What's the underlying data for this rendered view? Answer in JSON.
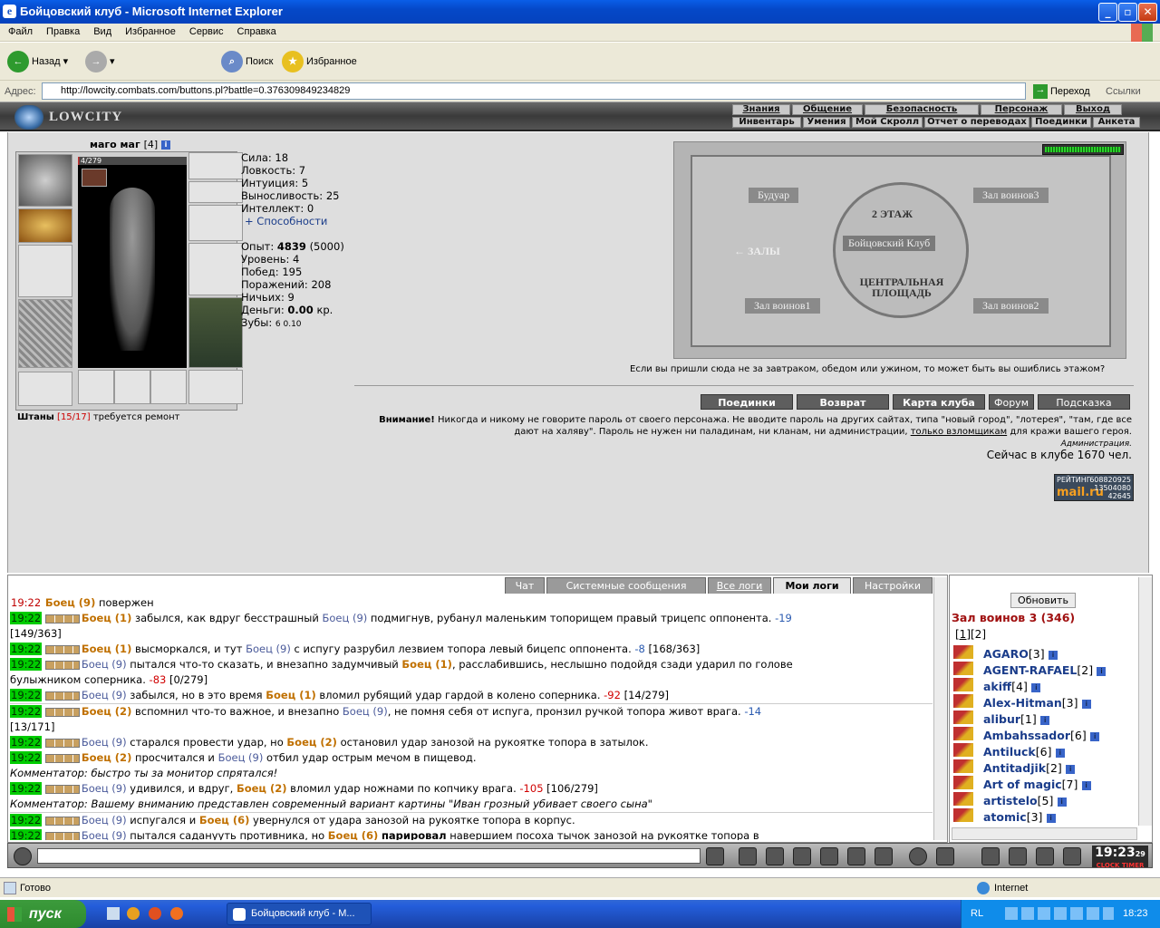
{
  "window": {
    "title": "Бойцовский клуб - Microsoft Internet Explorer"
  },
  "menu": [
    "Файл",
    "Правка",
    "Вид",
    "Избранное",
    "Сервис",
    "Справка"
  ],
  "toolbar": {
    "back": "Назад",
    "search": "Поиск",
    "favorites": "Избранное"
  },
  "address": {
    "label": "Адрес:",
    "url": "http://lowcity.combats.com/buttons.pl?battle=0.376309849234829",
    "go": "Переход",
    "links": "Ссылки"
  },
  "game": {
    "logo": "LOWCITY",
    "menu_top": [
      "Знания",
      "Общение",
      "Безопасность",
      "Персонаж",
      "Выход"
    ],
    "menu_bottom": [
      "Инвентарь",
      "Умения",
      "Мой Скролл",
      "Отчет о переводах",
      "Поединки",
      "Анкета"
    ]
  },
  "character": {
    "name": "маго маг",
    "level": "[4]",
    "hp": "4/279",
    "hp_fraction": 0.014,
    "stats": {
      "strength": "Сила: 18",
      "agility": "Ловкость: 7",
      "intuition": "Интуиция: 5",
      "endurance": "Выносливость: 25",
      "intellect": "Интеллект: 0",
      "abilities": "+ Способности"
    },
    "exp_label": "Опыт:",
    "exp_value": "4839",
    "exp_next": "(5000)",
    "level_line": "Уровень: 4",
    "wins": "Побед: 195",
    "losses": "Поражений: 208",
    "draws": "Ничьих: 9",
    "money_label": "Деньги:",
    "money_value": "0.00",
    "money_unit": "кр.",
    "teeth_label": "Зубы:",
    "teeth_value": "6 0.10",
    "repair_item": "Штаны",
    "repair_dur": "[15/17]",
    "repair_text": "требуется ремонт"
  },
  "map": {
    "labels": [
      "Будуар",
      "Зал воинов3",
      "2 ЭТАЖ",
      "Бойцовский Клуб",
      "← ЗАЛЫ",
      "ЦЕНТРАЛЬНАЯ ПЛОЩАДЬ",
      "Зал воинов1",
      "Зал воинов2"
    ],
    "caption": "Если вы пришли сюда не за завтраком, обедом или ужином, то может быть вы ошиблись этажом?"
  },
  "nav_buttons": [
    "Поединки",
    "Возврат",
    "Карта клуба",
    "Форум",
    "Подсказка"
  ],
  "warning": {
    "title": "Внимание!",
    "text": "Никогда и никому не говорите пароль от своего персонажа. Не вводите пароль на других сайтах, типа \"новый город\", \"лотерея\", \"там, где все дают на халяву\". Пароль не нужен ни паладинам, ни кланам, ни администрации,",
    "link": "только взломщикам",
    "tail": "для кражи вашего героя.",
    "sign": "Администрация."
  },
  "online": "Сейчас в клубе 1670 чел.",
  "rating": {
    "title": "РЕЙТИНГ",
    "brand": "mail.ru",
    "n1": "608820925",
    "n2": "13504080",
    "n3": "42645"
  },
  "log_tabs": [
    "Чат",
    "Системные сообщения",
    "Все логи",
    "Мои логи",
    "Настройки"
  ],
  "log": [
    {
      "t": "19:22",
      "red": true,
      "a": "Боец (9)",
      "text": " повержен"
    },
    {
      "t": "19:22",
      "a": "Боец (1)",
      "text": " забылся, как вдруг бесстрашный ",
      "b": "Боец (9)",
      "text2": " подмигнув, рубанул маленьким топорищем правый трицепс оппонента. ",
      "d": "-19",
      "hp": ""
    },
    {
      "cont": "[149/363]"
    },
    {
      "t": "19:22",
      "a": "Боец (1)",
      "text": " высморкался, и тут ",
      "b": "Боец (9)",
      "text2": " с испугу разрубил лезвием топора левый бицепс оппонента. ",
      "d": "-8",
      "hp": " [168/363]"
    },
    {
      "t": "19:22",
      "a9": "Боец (9)",
      "text": " пытался что-то сказать, и внезапно задумчивый ",
      "b1": "Боец (1)",
      "text2": ", расслабившись, неслышно подойдя сзади ударил по голове",
      "d": "",
      "hp": ""
    },
    {
      "cont": "булыжником соперника. ",
      "d": "-83",
      "hp": " [0/279]"
    },
    {
      "t": "19:22",
      "a9": "Боец (9)",
      "text": " забылся, но в это время ",
      "b1": "Боец (1)",
      "text2": " вломил рубящий удар гардой в колено соперника. ",
      "d": "-92",
      "hp": " [14/279]"
    },
    {
      "t": "19:22",
      "sep": true,
      "a": "Боец (2)",
      "text": " вспомнил что-то важное, и внезапно ",
      "b": "Боец (9)",
      "text2": ", не помня себя от испуга, пронзил ручкой топора живот врага. ",
      "d": "-14",
      "hp": ""
    },
    {
      "cont": "[13/171]"
    },
    {
      "t": "19:22",
      "a9": "Боец (9)",
      "text": " старался провести удар, но ",
      "b1": "Боец (2)",
      "text2": " остановил удар занозой на рукоятке топора в затылок.",
      "d": "",
      "hp": ""
    },
    {
      "t": "19:22",
      "a": "Боец (2)",
      "text": " просчитался и ",
      "b": "Боец (9)",
      "text2": " отбил удар острым мечом в пищевод.",
      "d": "",
      "hp": ""
    },
    {
      "comment": "Комментатор: быстро ты за монитор спрятался!"
    },
    {
      "t": "19:22",
      "a9": "Боец (9)",
      "text": " удивился, и вдруг, ",
      "b1": "Боец (2)",
      "text2": " вломил удар ножнами по копчику врага. ",
      "d": "-105",
      "hp": " [106/279]"
    },
    {
      "comment": "Комментатор: Вашему вниманию представлен современный вариант картины \"Иван грозный убивает своего сына\""
    },
    {
      "t": "19:22",
      "sep": true,
      "a9": "Боец (9)",
      "text": " испугался и ",
      "b1": "Боец (6)",
      "text2": " увернулся от удара занозой на рукоятке топора в корпус.",
      "d": "",
      "hp": ""
    },
    {
      "t": "19:22",
      "a9": "Боец (9)",
      "text": " пытался саданууть противника, но ",
      "b1": "Боец (6)",
      "text2": " ",
      "strong": "парировал",
      "text3": " навершием посоха тычок занозой на рукоятке топора в",
      "d": "",
      "hp": ""
    }
  ],
  "userpanel": {
    "refresh": "Обновить",
    "room": "Зал воинов 3 (346)",
    "pages": [
      "[1]",
      "[2]"
    ],
    "users": [
      {
        "n": "AGARO",
        "l": "[3]"
      },
      {
        "n": "AGENT-RAFAEL",
        "l": "[2]"
      },
      {
        "n": "akiff",
        "l": "[4]"
      },
      {
        "n": "Alex-Hitman",
        "l": "[3]"
      },
      {
        "n": "alibur",
        "l": "[1]"
      },
      {
        "n": "Ambahssador",
        "l": "[6]"
      },
      {
        "n": "Antiluck",
        "l": "[6]"
      },
      {
        "n": "Antitadjik",
        "l": "[2]"
      },
      {
        "n": "Art of magic",
        "l": "[7]"
      },
      {
        "n": "artistelo",
        "l": "[5]"
      },
      {
        "n": "atomic",
        "l": "[3]"
      }
    ]
  },
  "clock": {
    "time": "19:23",
    "sec": "29",
    "sub1": "CLOCK",
    "sub2": "TIMER"
  },
  "status": {
    "text": "Готово",
    "zone": "Internet"
  },
  "taskbar": {
    "start": "пуск",
    "item": "Бойцовский клуб - M...",
    "lang": "RL",
    "time": "18:23"
  }
}
